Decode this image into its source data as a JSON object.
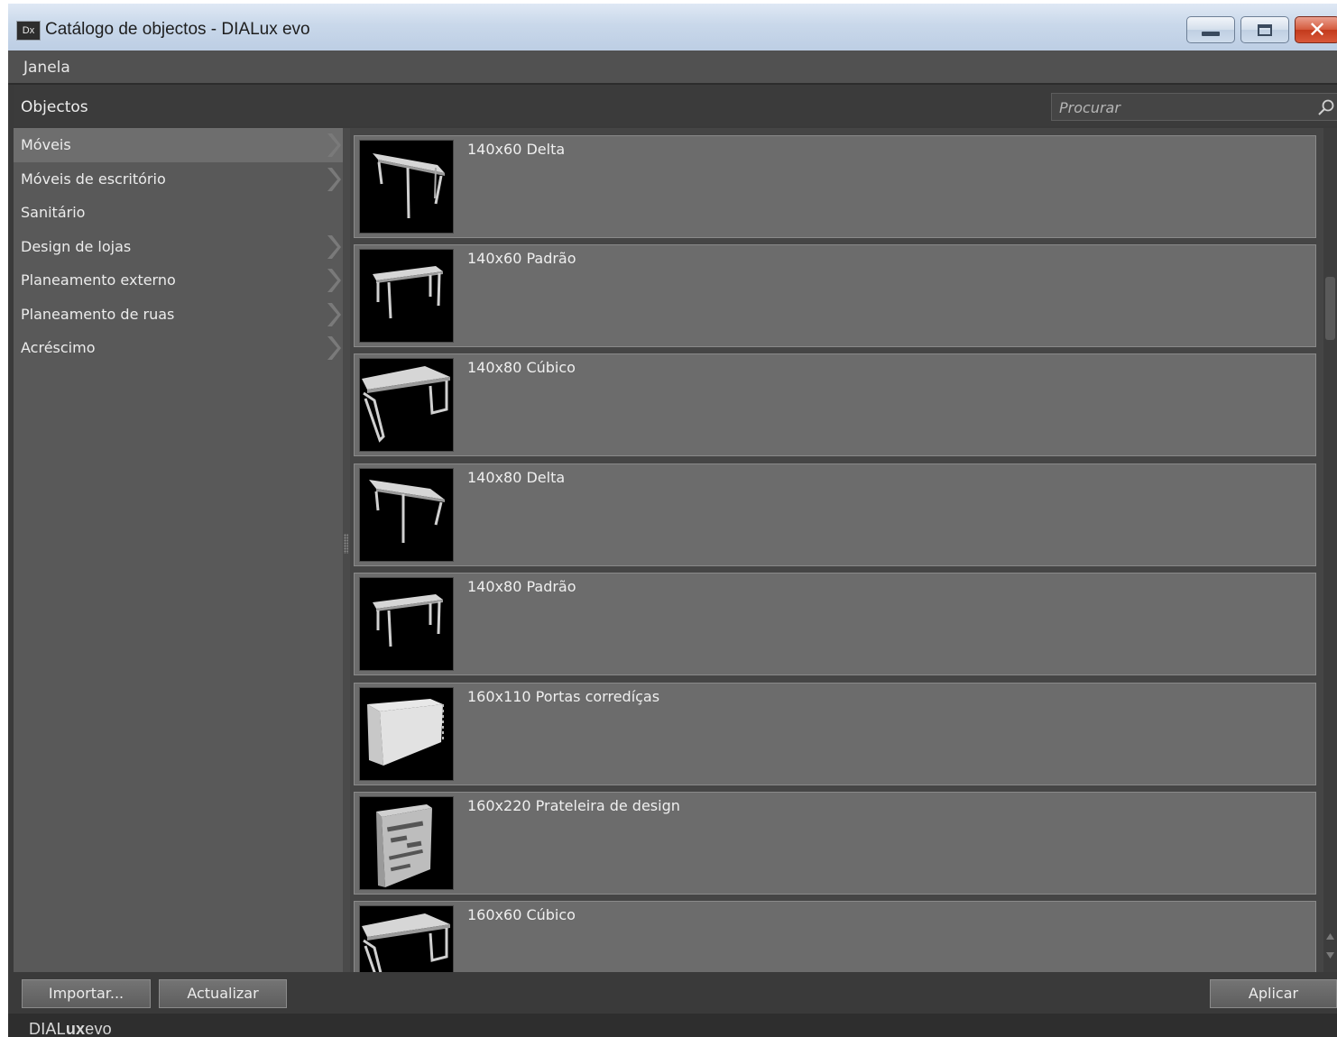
{
  "window": {
    "title": "Catálogo de objectos - DIALux evo",
    "app_icon_text": "Dx"
  },
  "menu": {
    "items": [
      "Janela"
    ]
  },
  "panel": {
    "title": "Objectos",
    "search_placeholder": "Procurar"
  },
  "sidebar": {
    "items": [
      {
        "label": "Móveis",
        "has_submenu": true,
        "selected": true
      },
      {
        "label": "Móveis de escritório",
        "has_submenu": true
      },
      {
        "label": "Sanitário",
        "has_submenu": false
      },
      {
        "label": "Design de lojas",
        "has_submenu": true
      },
      {
        "label": "Planeamento externo",
        "has_submenu": true
      },
      {
        "label": "Planeamento de ruas",
        "has_submenu": true
      },
      {
        "label": "Acréscimo",
        "has_submenu": true
      }
    ]
  },
  "objects": [
    {
      "label": "140x60 Delta",
      "icon": "delta-table-icon"
    },
    {
      "label": "140x60 Padrão",
      "icon": "standard-table-icon"
    },
    {
      "label": "140x80 Cúbico",
      "icon": "cubic-table-icon"
    },
    {
      "label": "140x80 Delta",
      "icon": "delta-table-icon"
    },
    {
      "label": "140x80 Padrão",
      "icon": "standard-table-icon"
    },
    {
      "label": "160x110 Portas corredíças",
      "icon": "sliding-door-cabinet-icon"
    },
    {
      "label": "160x220 Prateleira de design",
      "icon": "design-shelf-icon"
    },
    {
      "label": "160x60 Cúbico",
      "icon": "cubic-table-icon"
    }
  ],
  "buttons": {
    "import": "Importar...",
    "refresh": "Actualizar",
    "apply": "Aplicar"
  },
  "footer": {
    "brand_regular": "DIAL",
    "brand_bold": "ux",
    "brand_suffix": "evo"
  }
}
